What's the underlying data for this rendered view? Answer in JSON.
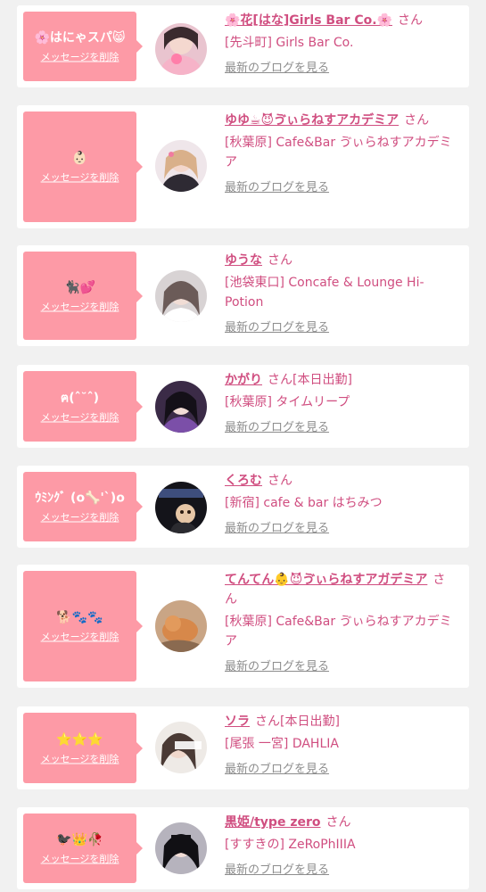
{
  "accent_color": "#fd9aa6",
  "name_color": "#d04e80",
  "delete_label": "メッセージを削除",
  "blog_label": "最新のブログを見る",
  "honorific": "さん",
  "entries": [
    {
      "message": "🌸はにゃスパ😸",
      "name": "🌸花[はな]Girls Bar Co.🌸",
      "status": "",
      "shop": "[先斗町] Girls Bar Co."
    },
    {
      "message": "👶🏻",
      "name": "ゆゆ☕😈ゔぃらねすアカデミア",
      "status": "",
      "shop": "[秋葉原] Cafe&Bar ゔぃらねすアカデミア"
    },
    {
      "message": "🐈‍⬛💕",
      "name": "ゆうな",
      "status": "",
      "shop": "[池袋東口] Concafe & Lounge Hi-Potion"
    },
    {
      "message": "ฅ(ˆ˘ˆ)",
      "name": "かがり",
      "status": "[本日出勤]",
      "shop": "[秋葉原] タイムリープ"
    },
    {
      "message": "ｳﾐﾝｸﾞ (o🦴'`)o",
      "name": "くろむ",
      "status": "",
      "shop": "[新宿] cafe & bar はちみつ"
    },
    {
      "message": "🐕🐾🐾",
      "name": "てんてん👶😈ゔぃらねすアガデミア",
      "status": "",
      "shop": "[秋葉原] Cafe&Bar ゔぃらねすアカデミア"
    },
    {
      "message": "⭐⭐⭐",
      "name": "ソラ",
      "status": "[本日出勤]",
      "shop": "[尾張 一宮] DAHLIA"
    },
    {
      "message": "🐦‍⬛👑🥀",
      "name": "黒姫/type zero",
      "status": "",
      "shop": "[すすきの] ZeRoPhIIIA"
    }
  ]
}
